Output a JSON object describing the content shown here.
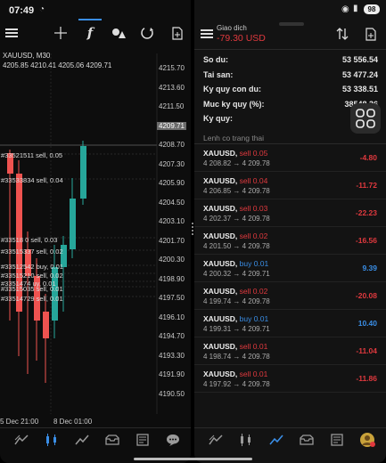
{
  "status": {
    "time": "07:49",
    "battery": "98"
  },
  "chart": {
    "symbol": "XAUUSD, M30",
    "ohlc": "4205.85 4210.41 4205.06 4209.71",
    "prices": [
      "4215.70",
      "4213.60",
      "4211.50",
      "4209.71",
      "4208.70",
      "4207.30",
      "4205.90",
      "4204.50",
      "4203.10",
      "4201.70",
      "4200.30",
      "4198.90",
      "4197.50",
      "4196.10",
      "4194.70",
      "4193.30",
      "4191.90",
      "4190.50"
    ],
    "current_price": "4209.71",
    "time_labels": [
      "5 Dec 21:00",
      "8 Dec 01:00"
    ],
    "trade_labels": [
      {
        "text": "#33521511 sell, 0.05"
      },
      {
        "text": "#33533834 sell, 0.04"
      },
      {
        "text": "#33518   0 sell, 0.03"
      },
      {
        "text": "#33515337 sell, 0.02"
      },
      {
        "text": "#33512542 buy, 0.01"
      },
      {
        "text": "#33515210 sell, 0.02"
      },
      {
        "text": "#3351474  uy, 0.01"
      },
      {
        "text": "#33515035 sell, 0.01"
      },
      {
        "text": "#33514729 sell, 0.01"
      }
    ]
  },
  "account": {
    "title": "Giao dich",
    "profit": "-79.30 USD",
    "rows": [
      {
        "label": "So du:",
        "value": "53 556.54"
      },
      {
        "label": "Tai san:",
        "value": "53 477.24"
      },
      {
        "label": "Ky quy con du:",
        "value": "53 338.51"
      },
      {
        "label": "Muc ky quy (%):",
        "value": "38548.36"
      },
      {
        "label": "Ky quy:",
        "value": ""
      }
    ],
    "section": "Lenh co trang thai",
    "positions": [
      {
        "symbol": "XAUUSD,",
        "side": "sell 0.05",
        "prices": "4 208.82 → 4 209.78",
        "pl": "-4.80",
        "type": "sell"
      },
      {
        "symbol": "XAUUSD,",
        "side": "sell 0.04",
        "prices": "4 206.85 → 4 209.78",
        "pl": "-11.72",
        "type": "sell"
      },
      {
        "symbol": "XAUUSD,",
        "side": "sell 0.03",
        "prices": "4 202.37 → 4 209.78",
        "pl": "-22.23",
        "type": "sell"
      },
      {
        "symbol": "XAUUSD,",
        "side": "sell 0.02",
        "prices": "4 201.50 → 4 209.78",
        "pl": "-16.56",
        "type": "sell"
      },
      {
        "symbol": "XAUUSD,",
        "side": "buy 0.01",
        "prices": "4 200.32 → 4 209.71",
        "pl": "9.39",
        "type": "buy"
      },
      {
        "symbol": "XAUUSD,",
        "side": "sell 0.02",
        "prices": "4 199.74 → 4 209.78",
        "pl": "-20.08",
        "type": "sell"
      },
      {
        "symbol": "XAUUSD,",
        "side": "buy 0.01",
        "prices": "4 199.31 → 4 209.71",
        "pl": "10.40",
        "type": "buy"
      },
      {
        "symbol": "XAUUSD,",
        "side": "sell 0.01",
        "prices": "4 198.74 → 4 209.78",
        "pl": "-11.04",
        "type": "sell"
      },
      {
        "symbol": "XAUUSD,",
        "side": "sell 0.01",
        "prices": "4 197.92 → 4 209.78",
        "pl": "-11.86",
        "type": "sell"
      }
    ]
  },
  "colors": {
    "bull": "#26a69a",
    "bear": "#ef5350",
    "accent": "#3a8ee6",
    "loss": "#e0393e"
  },
  "icons": {
    "left_toolbar": [
      "menu-icon",
      "crosshair-icon",
      "indicator-icon",
      "objects-icon",
      "timeframe-icon",
      "new-order-icon"
    ],
    "right_toolbar": [
      "sort-icon",
      "new-order-icon"
    ],
    "nav": [
      "quotes-icon",
      "chart-icon",
      "trade-icon",
      "history-icon",
      "news-icon",
      "messages-icon"
    ]
  }
}
